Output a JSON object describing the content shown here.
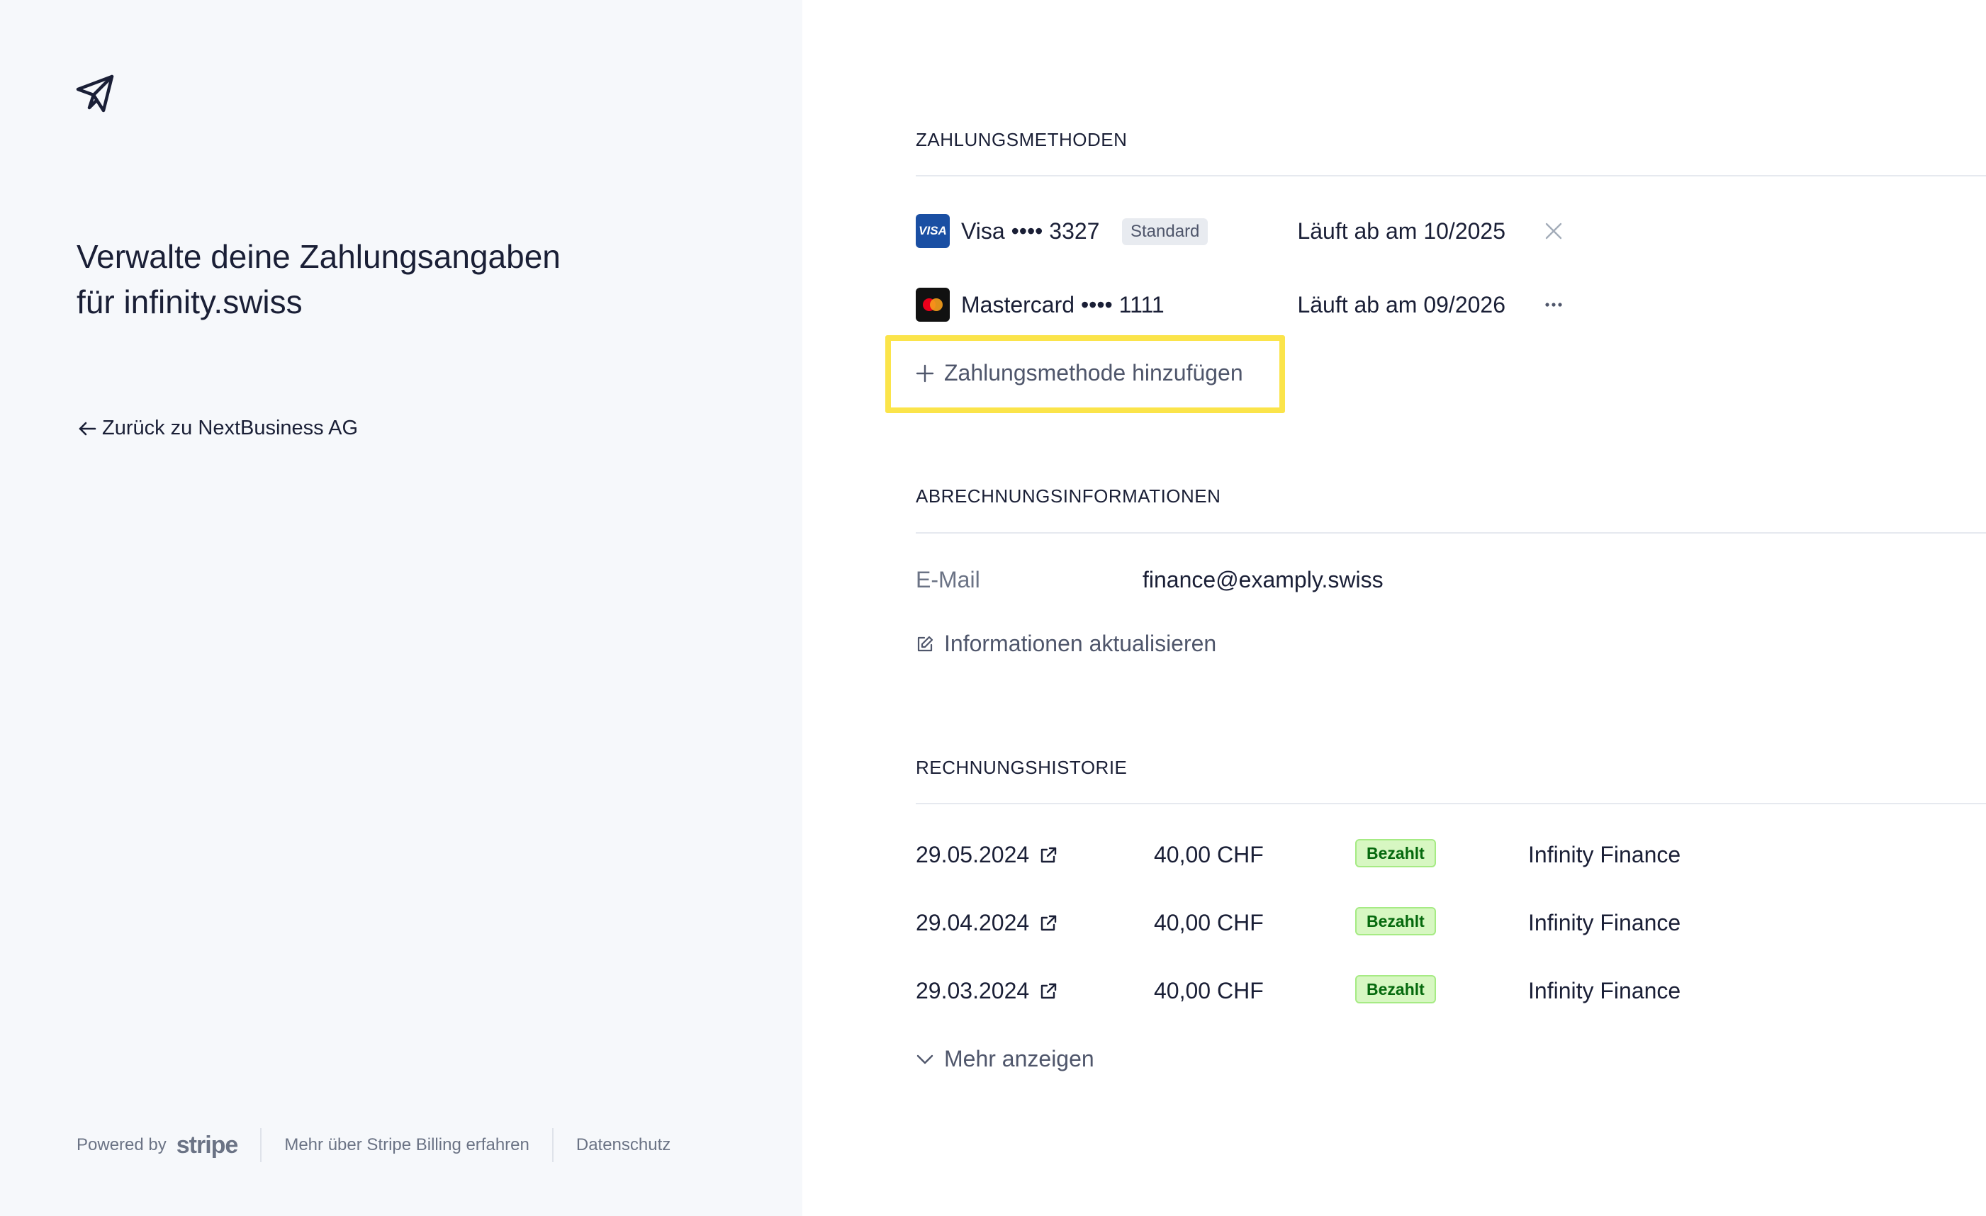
{
  "sidebar": {
    "headline": "Verwalte deine Zahlungsangaben für infinity.swiss",
    "back_link": "Zurück zu NextBusiness AG",
    "footer": {
      "powered_by": "Powered by",
      "brand": "stripe",
      "learn_more": "Mehr über Stripe Billing erfahren",
      "privacy": "Datenschutz"
    }
  },
  "payment_methods": {
    "title": "ZAHLUNGSMETHODEN",
    "items": [
      {
        "brand": "Visa",
        "brand_logo_text": "VISA",
        "name": "Visa •••• 3327",
        "badge": "Standard",
        "expiry": "Läuft ab am 10/2025",
        "action_icon": "close-icon"
      },
      {
        "brand": "Mastercard",
        "name": "Mastercard •••• 1111",
        "expiry": "Läuft ab am 09/2026",
        "action_icon": "more-options-icon"
      }
    ],
    "add_label": "Zahlungsmethode hinzufügen",
    "highlight_color": "#fbe44a"
  },
  "billing_info": {
    "title": "ABRECHNUNGSINFORMATIONEN",
    "email_label": "E-Mail",
    "email_value": "finance@examply.swiss",
    "update_label": "Informationen aktualisieren"
  },
  "invoice_history": {
    "title": "RECHNUNGSHISTORIE",
    "rows": [
      {
        "date": "29.05.2024",
        "amount": "40,00 CHF",
        "status": "Bezahlt",
        "company": "Infinity Finance"
      },
      {
        "date": "29.04.2024",
        "amount": "40,00 CHF",
        "status": "Bezahlt",
        "company": "Infinity Finance"
      },
      {
        "date": "29.03.2024",
        "amount": "40,00 CHF",
        "status": "Bezahlt",
        "company": "Infinity Finance"
      }
    ],
    "more_label": "Mehr anzeigen"
  },
  "colors": {
    "sidebar_bg": "#f6f8fb",
    "text": "#1a1f36",
    "muted": "#6b7385",
    "paid_bg": "#d7f7c2",
    "paid_text": "#05690d",
    "visa_blue": "#1a4fa3"
  }
}
